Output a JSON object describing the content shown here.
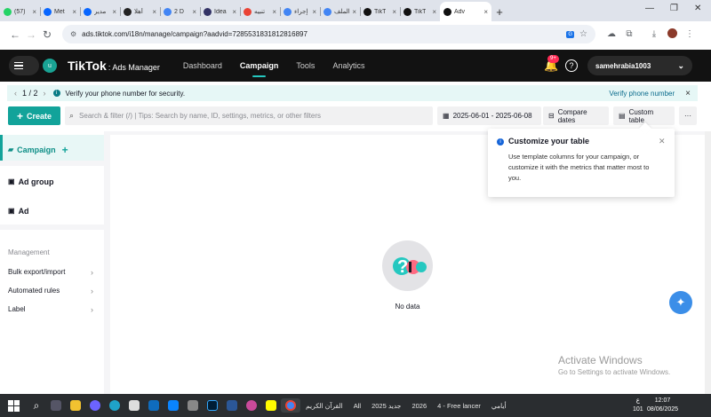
{
  "browser": {
    "tabs": [
      {
        "label": "(57)",
        "color": "#25d366"
      },
      {
        "label": "Met",
        "color": "#0866ff"
      },
      {
        "label": "مدير",
        "color": "#0866ff"
      },
      {
        "label": "أهلا",
        "color": "#222222"
      },
      {
        "label": "2 D",
        "color": "#4285f4"
      },
      {
        "label": "Idea",
        "color": "#333366"
      },
      {
        "label": "تنبيه",
        "color": "#ea4335"
      },
      {
        "label": "إجراء",
        "color": "#4285f4"
      },
      {
        "label": "الملف",
        "color": "#4285f4"
      },
      {
        "label": "TikT",
        "color": "#111111"
      },
      {
        "label": "TikT",
        "color": "#111111"
      },
      {
        "label": "Adv",
        "color": "#111111",
        "active": true
      }
    ],
    "new_tab_icon": "+",
    "url": "ads.tiktok.com/i18n/manage/campaign?aadvid=7285531831812816897",
    "window_controls": {
      "minimize": "—",
      "restore": "❐",
      "close": "✕"
    }
  },
  "topnav": {
    "avatar_initial": "u",
    "logo": "TikTok",
    "logo_sub": ": Ads Manager",
    "links": [
      "Dashboard",
      "Campaign",
      "Tools",
      "Analytics"
    ],
    "active_link": "Campaign",
    "notification_badge": "9+",
    "account": "samehrabia1003"
  },
  "notice": {
    "counter": "1 / 2",
    "message": "Verify your phone number for security.",
    "link": "Verify phone number"
  },
  "toolbar": {
    "create_label": "Create",
    "search_placeholder": "Search & filter (/) | Tips: Search by name, ID, settings, metrics, or other filters",
    "date_range": "2025-06-01 - 2025-06-08",
    "compare_label": "Compare dates",
    "custom_table_label": "Custom table",
    "more_label": "···"
  },
  "sidebar": {
    "items": [
      {
        "label": "Campaign",
        "active": true
      },
      {
        "label": "Ad group"
      },
      {
        "label": "Ad"
      }
    ],
    "section_title": "Management",
    "links": [
      "Bulk export/import",
      "Automated rules",
      "Label"
    ]
  },
  "main": {
    "empty_text": "No data"
  },
  "popover": {
    "title": "Customize your table",
    "body": "Use template columns for your campaign, or customize it with the metrics that matter most to you."
  },
  "watermark": {
    "title": "Activate Windows",
    "subtitle": "Go to Settings to activate Windows."
  },
  "taskbar": {
    "labels": [
      "القرآن الكريم",
      "All",
      "جديد 2025",
      "2026",
      "4 - Free lancer",
      "أيامي"
    ],
    "lang_top": "ع",
    "lang_bottom": "101",
    "time": "12:07",
    "date": "08/06/2025"
  },
  "colors": {
    "accent": "#12a39a",
    "nav_bg": "#121212",
    "notice_bg": "#e6f7f6"
  }
}
